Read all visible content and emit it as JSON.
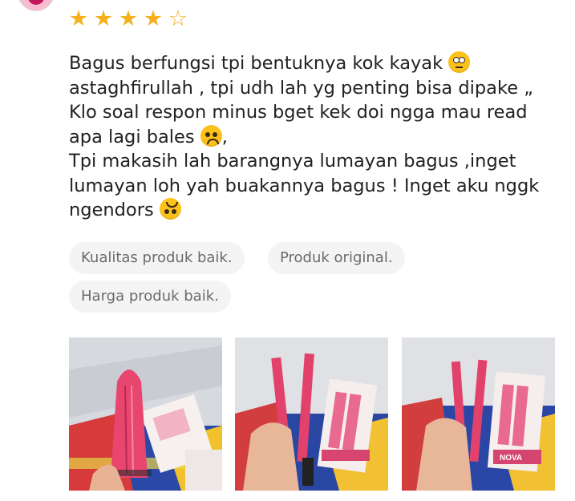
{
  "rating": {
    "stars": [
      {
        "icon": "star-filled",
        "filled": true
      },
      {
        "icon": "star-filled",
        "filled": true
      },
      {
        "icon": "star-filled",
        "filled": true
      },
      {
        "icon": "star-filled",
        "filled": true
      },
      {
        "icon": "star-outline",
        "filled": false
      }
    ],
    "value": 4,
    "max": 5,
    "color": "#f6b01e"
  },
  "review": {
    "lines": [
      {
        "text": "Bagus berfungsi tpi bentuknya kok kayak ",
        "emoji": "face-with-rolling-eyes"
      },
      {
        "text": "astaghfirullah , tpi udh lah yg penting bisa dipake „"
      },
      {
        "text": "Klo soal respon minus bget kek doi ngga mau read"
      },
      {
        "text": "apa lagi bales ",
        "emoji": "frowning-face",
        "suffix": ","
      },
      {
        "text": "Tpi makasih lah barangnya lumayan bagus ,inget"
      },
      {
        "text": "lumayan loh yah buakannya bagus ! Inget aku nggk"
      },
      {
        "text": "ngendors ",
        "emoji": "upside-down-face"
      }
    ]
  },
  "tags": [
    {
      "label": "Kualitas produk baik."
    },
    {
      "label": "Produk original."
    },
    {
      "label": "Harga produk baik."
    }
  ],
  "photos": [
    {
      "name": "review-photo-1",
      "subject": "pink hair straightener closed"
    },
    {
      "name": "review-photo-2",
      "subject": "pink hair straightener open with box"
    },
    {
      "name": "review-photo-3",
      "subject": "pink hair straightener open with NOVA box"
    }
  ],
  "photo_box_label": "NOVA"
}
